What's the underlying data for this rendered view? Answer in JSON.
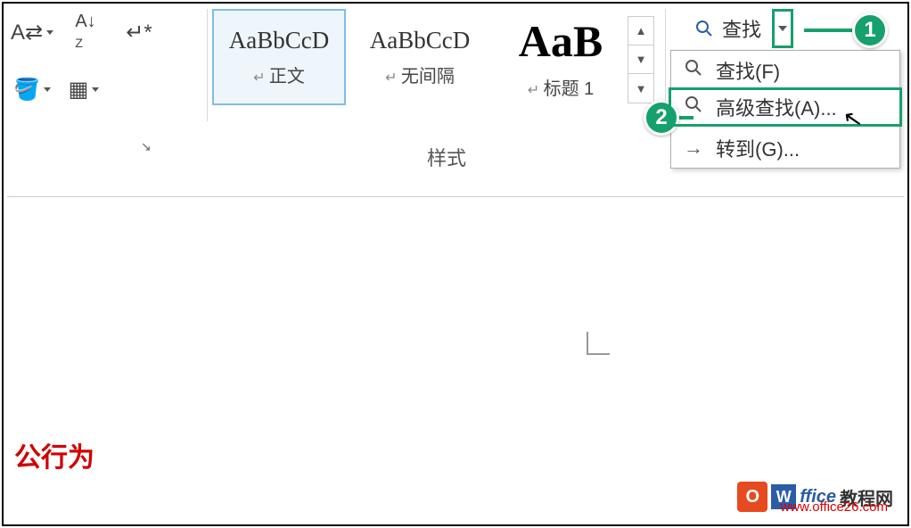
{
  "ribbon": {
    "find_label": "查找",
    "styles_label": "样式",
    "styles": [
      {
        "preview": "AaBbCcD",
        "name": "正文",
        "selected": true
      },
      {
        "preview": "AaBbCcD",
        "name": "无间隔",
        "selected": false
      },
      {
        "preview": "AaB",
        "name": "标题 1",
        "selected": false
      }
    ]
  },
  "dropdown": {
    "items": [
      {
        "icon": "search",
        "label": "查找(F)"
      },
      {
        "icon": "search",
        "label": "高级查找(A)...",
        "highlight": true
      },
      {
        "icon": "arrow",
        "label": "转到(G)..."
      }
    ]
  },
  "callouts": {
    "c1": "1",
    "c2": "2"
  },
  "document": {
    "text_fragment": "公行为"
  },
  "watermark": {
    "brand": "ffice",
    "site": "www.office26.com",
    "label2": "教程网"
  }
}
